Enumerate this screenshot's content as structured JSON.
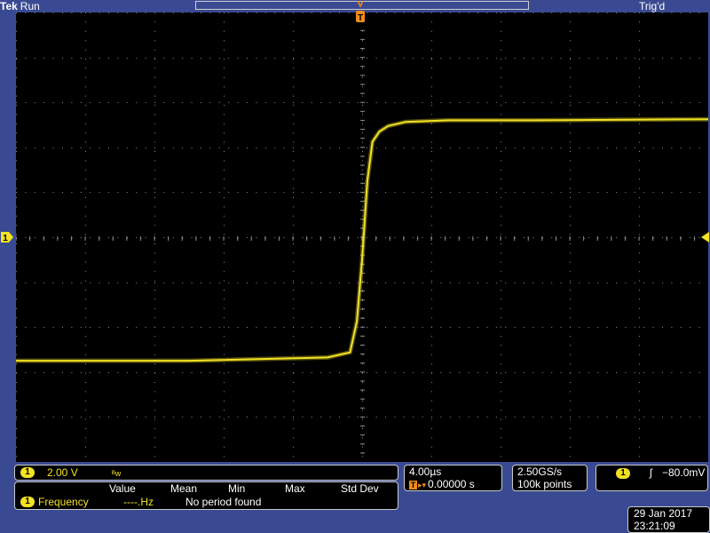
{
  "header": {
    "brand": "Tek",
    "run_state": "Run",
    "trigger_state": "Trig'd"
  },
  "colors": {
    "background": "#3a4a92",
    "screen": "#000000",
    "channel1": "#f2e224",
    "trigger": "#f28c1a",
    "grid": "#8a8a8a"
  },
  "channel": {
    "badge": "1",
    "scale": "2.00 V",
    "bandwidth_icon": "bandwidth-limit-icon",
    "bandwidth_glyph": "ᴮw"
  },
  "measurement": {
    "headers": [
      "Value",
      "Mean",
      "Min",
      "Max",
      "Std Dev"
    ],
    "badge": "1",
    "name": "Frequency",
    "value": "----.Hz",
    "status": "No period found"
  },
  "timebase": {
    "scale": "4.00µs",
    "trigger_glyph": "T",
    "arrows": "▸▾",
    "position": "0.00000 s"
  },
  "acquisition": {
    "sample_rate": "2.50GS/s",
    "points": "100k points"
  },
  "trigger": {
    "badge": "1",
    "slope_glyph": "ʃ",
    "level": "−80.0mV"
  },
  "datetime": {
    "date": "29 Jan  2017",
    "time": "23:21:09"
  },
  "markers": {
    "ch1_ground": "1",
    "trigger_top": "T"
  },
  "chart_data": {
    "type": "line",
    "title": "",
    "xlabel": "",
    "ylabel": "",
    "xlim": [
      -20,
      20
    ],
    "ylim": [
      -4,
      4
    ],
    "series": [
      {
        "x": [
          -20,
          -10,
          -2,
          -0.7,
          -0.3,
          0,
          0.3,
          0.6,
          1,
          1.5,
          2.5,
          5,
          10,
          20
        ],
        "y": [
          -2.2,
          -2.2,
          -2.14,
          -2.05,
          -1.5,
          -0.4,
          1.0,
          1.7,
          1.88,
          1.98,
          2.05,
          2.08,
          2.08,
          2.1
        ]
      }
    ]
  }
}
